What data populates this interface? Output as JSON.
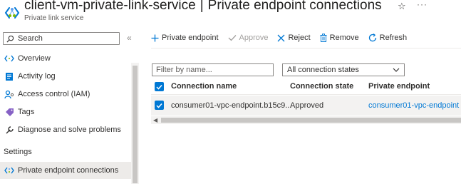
{
  "header": {
    "resource_name": "client-vm-private-link-service",
    "separator": "|",
    "page_title": "Private endpoint connections",
    "resource_type": "Private link service",
    "favorite_icon": "star-outline-icon",
    "more_label": "···"
  },
  "sidebar": {
    "search_placeholder": "Search",
    "collapse_glyph": "«",
    "items": [
      {
        "label": "Overview",
        "icon": "overview-icon"
      },
      {
        "label": "Activity log",
        "icon": "activity-log-icon"
      },
      {
        "label": "Access control (IAM)",
        "icon": "iam-icon"
      },
      {
        "label": "Tags",
        "icon": "tag-icon"
      },
      {
        "label": "Diagnose and solve problems",
        "icon": "wrench-icon"
      }
    ],
    "section_settings": "Settings",
    "settings_items": [
      {
        "label": "Private endpoint connections",
        "icon": "private-link-icon",
        "active": true
      }
    ]
  },
  "toolbar": {
    "add_label": "Private endpoint",
    "approve_label": "Approve",
    "reject_label": "Reject",
    "remove_label": "Remove",
    "refresh_label": "Refresh"
  },
  "filters": {
    "name_placeholder": "Filter by name...",
    "state_value": "All connection states"
  },
  "table": {
    "columns": [
      "Connection name",
      "Connection state",
      "Private endpoint"
    ],
    "rows": [
      {
        "connection_name": "consumer01-vpc-endpoint.b15c9...",
        "connection_state": "Approved",
        "private_endpoint": "consumer01-vpc-endpoint",
        "selected": true
      }
    ]
  },
  "colors": {
    "accent": "#0078d4",
    "selected_row": "#f3f2f1",
    "disabled_text": "#a19f9d"
  }
}
